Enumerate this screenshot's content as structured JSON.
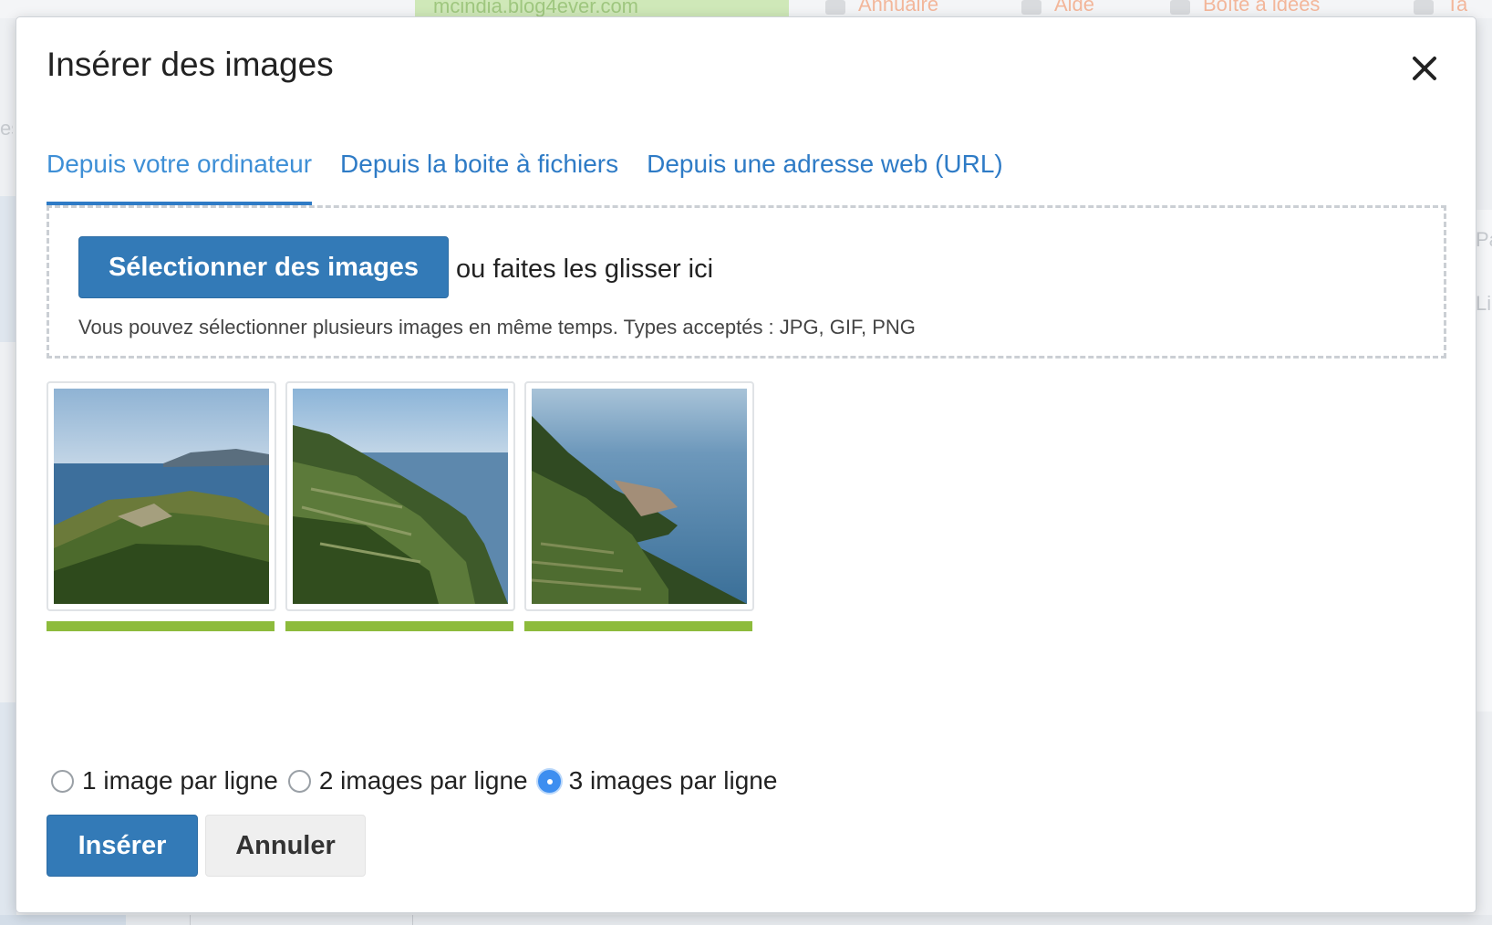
{
  "background": {
    "site_label": "mcindia.blog4ever.com",
    "menu": [
      "Annuaire",
      "Aide",
      "Boîte à idées",
      "Ta"
    ],
    "left_fragment": "es",
    "right_fragments": [
      "Pa",
      "Lie"
    ]
  },
  "modal": {
    "title": "Insérer des images",
    "close_icon": "close-icon",
    "tabs": [
      {
        "label": "Depuis votre ordinateur",
        "active": true
      },
      {
        "label": "Depuis la boite à fichiers",
        "active": false
      },
      {
        "label": "Depuis une adresse web (URL)",
        "active": false
      }
    ],
    "dropzone": {
      "select_button": "Sélectionner des images",
      "drop_text": "ou faites les glisser ici",
      "help_text": "Vous pouvez sélectionner plusieurs images en même temps. Types acceptés : JPG, GIF, PNG"
    },
    "images": [
      {
        "upload_progress": 1.0
      },
      {
        "upload_progress": 1.0
      },
      {
        "upload_progress": 1.0
      }
    ],
    "layout_options": [
      {
        "label": "1 image par ligne",
        "checked": false
      },
      {
        "label": "2 images par ligne",
        "checked": false
      },
      {
        "label": "3 images par ligne",
        "checked": true
      }
    ],
    "insert_button": "Insérer",
    "cancel_button": "Annuler"
  },
  "colors": {
    "primary": "#337ab7",
    "tab_link": "#2e7bc6",
    "progress": "#8dbb3c",
    "radio_checked": "#3d8ef0"
  }
}
